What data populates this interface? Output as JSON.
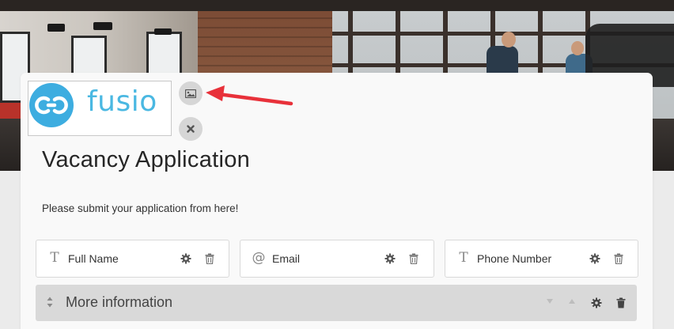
{
  "header": {
    "logo": {
      "text": "fusio",
      "icon": "link-icon"
    },
    "image_button": {
      "icon": "image-icon"
    },
    "remove_button": {
      "icon": "close-icon"
    },
    "annotation_arrow": {
      "color": "#e8313a"
    }
  },
  "form": {
    "title": "Vacancy Application",
    "description": "Please submit your application from here!",
    "fields": [
      {
        "label": "Full Name",
        "type_icon": "T",
        "type": "text"
      },
      {
        "label": "Email",
        "type_icon": "@",
        "type": "email"
      },
      {
        "label": "Phone Number",
        "type_icon": "T",
        "type": "text"
      }
    ],
    "section": {
      "label": "More information"
    }
  },
  "colors": {
    "brand": "#3dade0",
    "background": "#ebebeb",
    "card": "#f9f9f9",
    "section_bar": "#d9d9d9"
  }
}
